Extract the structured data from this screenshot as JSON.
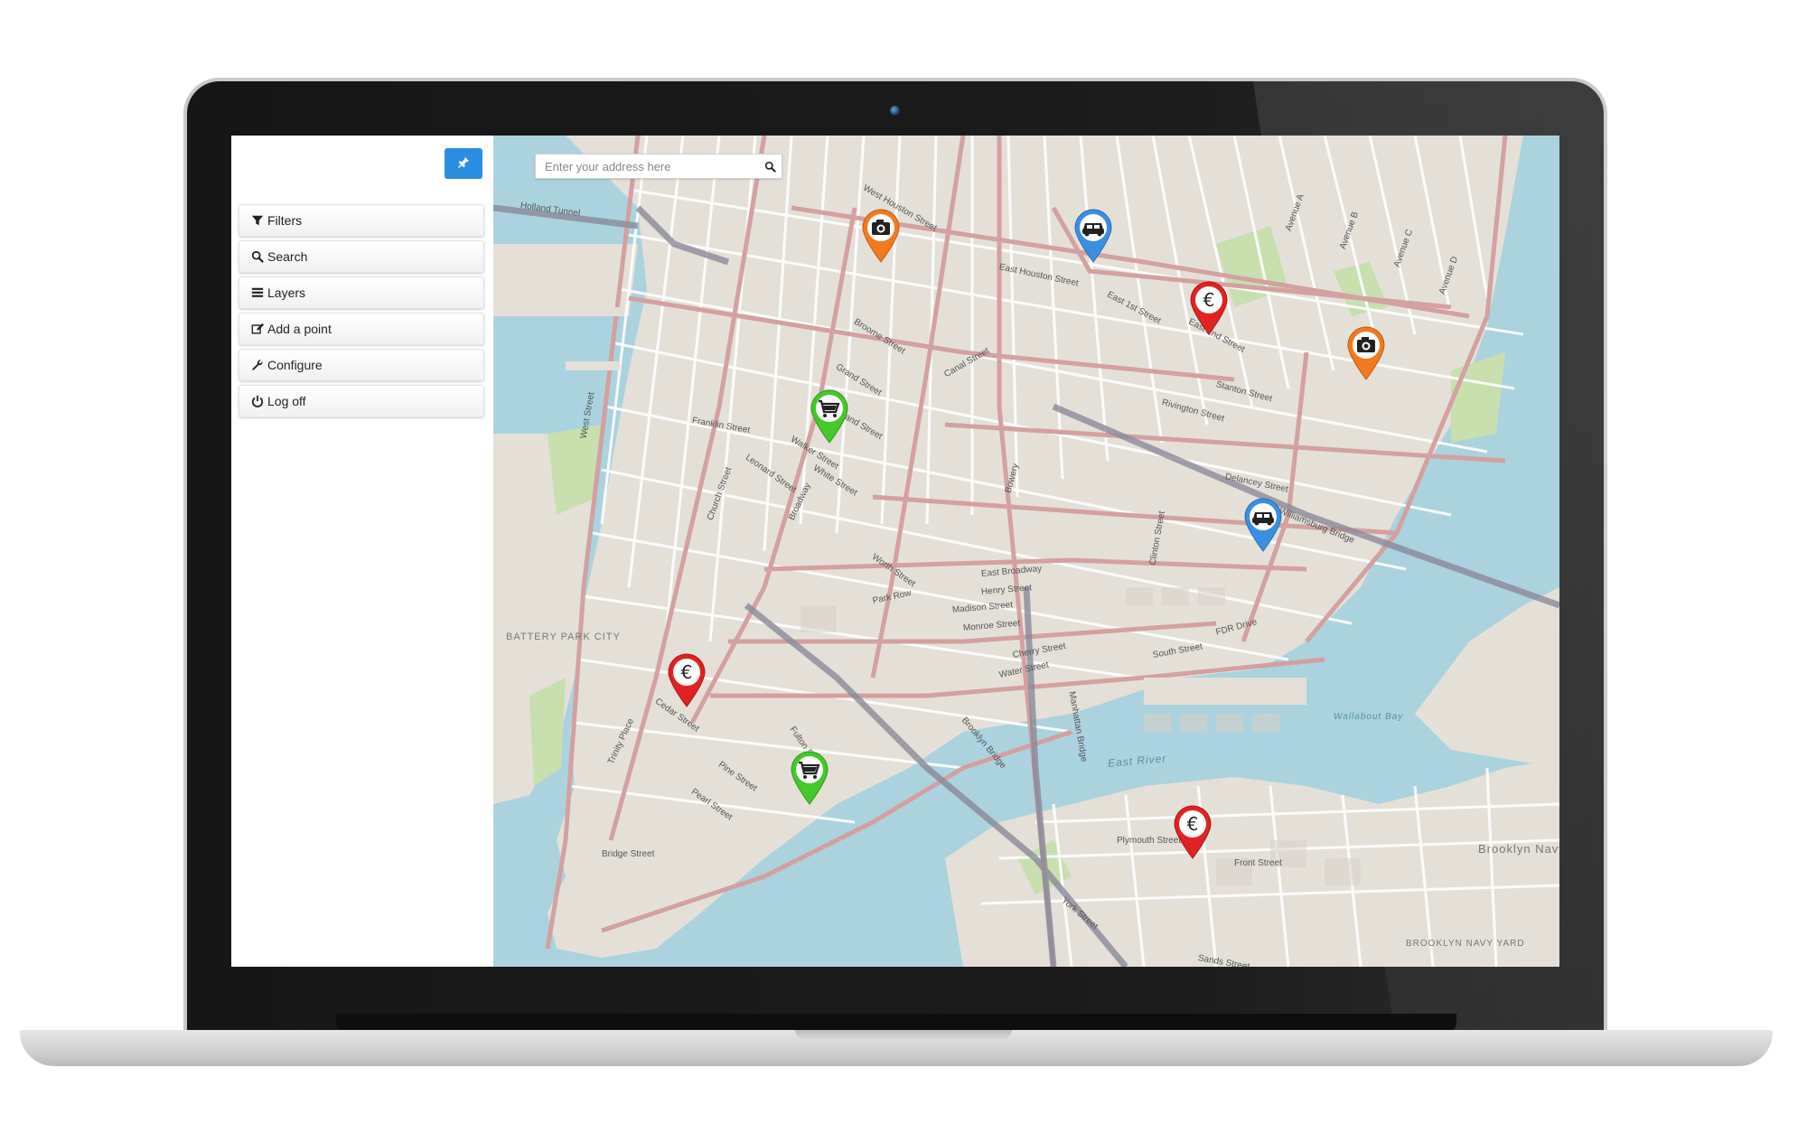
{
  "sidebar": {
    "pin_button_icon": "pin-icon",
    "items": [
      {
        "label": "Filters",
        "icon": "filter-icon"
      },
      {
        "label": "Search",
        "icon": "search-icon"
      },
      {
        "label": "Layers",
        "icon": "layers-icon"
      },
      {
        "label": "Add a point",
        "icon": "edit-icon"
      },
      {
        "label": "Configure",
        "icon": "wrench-icon"
      },
      {
        "label": "Log off",
        "icon": "power-icon"
      }
    ]
  },
  "map": {
    "search": {
      "placeholder": "Enter your address here",
      "value": ""
    },
    "colors": {
      "water": "#aad3df",
      "land": "#e4e0d8",
      "park": "#c8dfae",
      "major_road": "#d4a0a0",
      "minor_road": "#ffffff",
      "accent_button": "#2b8de0"
    },
    "markers": [
      {
        "type": "camera",
        "color": "#f07a20",
        "icon": "camera-icon"
      },
      {
        "type": "car",
        "color": "#3b8fe0",
        "icon": "car-icon"
      },
      {
        "type": "euro",
        "color": "#e02222",
        "icon": "euro-icon"
      },
      {
        "type": "camera",
        "color": "#f07a20",
        "icon": "camera-icon"
      },
      {
        "type": "shopping",
        "color": "#44c82a",
        "icon": "cart-icon"
      },
      {
        "type": "car",
        "color": "#3b8fe0",
        "icon": "car-icon"
      },
      {
        "type": "euro",
        "color": "#e02222",
        "icon": "euro-icon"
      },
      {
        "type": "shopping",
        "color": "#44c82a",
        "icon": "cart-icon"
      },
      {
        "type": "euro",
        "color": "#e02222",
        "icon": "euro-icon"
      }
    ],
    "street_labels": [
      "Holland Tunnel",
      "West Houston Street",
      "East Houston Street",
      "Broome Street",
      "Grand Street",
      "Canal Street",
      "Walker Street",
      "White Street",
      "Franklin Street",
      "Leonard Street",
      "Worth Street",
      "Park Row",
      "East Broadway",
      "Henry Street",
      "Madison Street",
      "Monroe Street",
      "Cherry Street",
      "Water Street",
      "South Street",
      "FDR Drive",
      "Brooklyn Bridge",
      "Manhattan Bridge",
      "Williamsburg Bridge",
      "Delancey Street",
      "Rivington Street",
      "Stanton Street",
      "East 2nd Street",
      "East 1st Street",
      "Bowery",
      "Broadway",
      "West Street",
      "Church Street",
      "Front Street",
      "Plymouth Street",
      "Sands Street",
      "York Street",
      "Bridge Street",
      "Pearl Street",
      "Pine Street",
      "Fulton Street",
      "Cedar Street",
      "Trinity Place",
      "Avenue A",
      "Avenue B",
      "Avenue C",
      "Avenue D",
      "Clinton Street",
      "Grand Street"
    ],
    "area_labels": [
      "BATTERY PARK CITY",
      "East River",
      "Wallabout Bay",
      "Brooklyn Navy Yard",
      "BROOKLYN NAVY YARD"
    ]
  }
}
